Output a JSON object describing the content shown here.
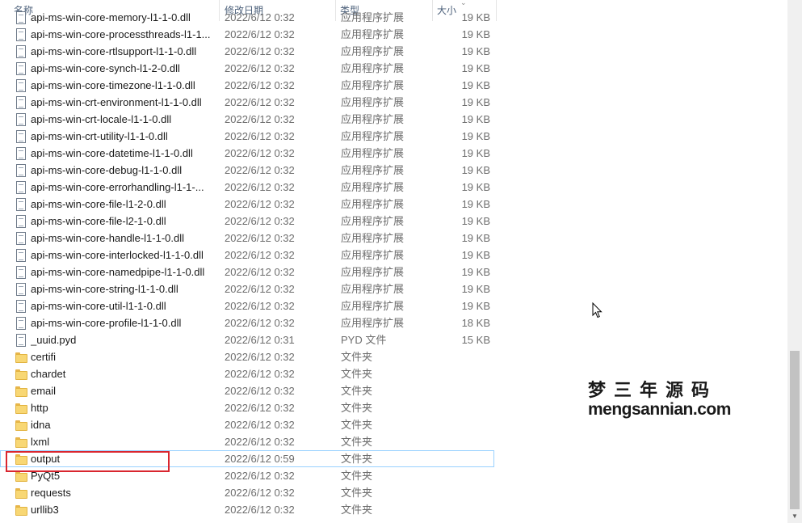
{
  "header": {
    "name": "名称",
    "date": "修改日期",
    "type": "类型",
    "size": "大小",
    "sort_indicator": "chevron-up-icon"
  },
  "rows": [
    {
      "name": "api-ms-win-core-memory-l1-1-0.dll",
      "date": "2022/6/12 0:32",
      "type": "应用程序扩展",
      "size": "19 KB",
      "icon": "dll-file-icon"
    },
    {
      "name": "api-ms-win-core-processthreads-l1-1...",
      "date": "2022/6/12 0:32",
      "type": "应用程序扩展",
      "size": "19 KB",
      "icon": "dll-file-icon"
    },
    {
      "name": "api-ms-win-core-rtlsupport-l1-1-0.dll",
      "date": "2022/6/12 0:32",
      "type": "应用程序扩展",
      "size": "19 KB",
      "icon": "dll-file-icon"
    },
    {
      "name": "api-ms-win-core-synch-l1-2-0.dll",
      "date": "2022/6/12 0:32",
      "type": "应用程序扩展",
      "size": "19 KB",
      "icon": "dll-file-icon"
    },
    {
      "name": "api-ms-win-core-timezone-l1-1-0.dll",
      "date": "2022/6/12 0:32",
      "type": "应用程序扩展",
      "size": "19 KB",
      "icon": "dll-file-icon"
    },
    {
      "name": "api-ms-win-crt-environment-l1-1-0.dll",
      "date": "2022/6/12 0:32",
      "type": "应用程序扩展",
      "size": "19 KB",
      "icon": "dll-file-icon"
    },
    {
      "name": "api-ms-win-crt-locale-l1-1-0.dll",
      "date": "2022/6/12 0:32",
      "type": "应用程序扩展",
      "size": "19 KB",
      "icon": "dll-file-icon"
    },
    {
      "name": "api-ms-win-crt-utility-l1-1-0.dll",
      "date": "2022/6/12 0:32",
      "type": "应用程序扩展",
      "size": "19 KB",
      "icon": "dll-file-icon"
    },
    {
      "name": "api-ms-win-core-datetime-l1-1-0.dll",
      "date": "2022/6/12 0:32",
      "type": "应用程序扩展",
      "size": "19 KB",
      "icon": "dll-file-icon"
    },
    {
      "name": "api-ms-win-core-debug-l1-1-0.dll",
      "date": "2022/6/12 0:32",
      "type": "应用程序扩展",
      "size": "19 KB",
      "icon": "dll-file-icon"
    },
    {
      "name": "api-ms-win-core-errorhandling-l1-1-...",
      "date": "2022/6/12 0:32",
      "type": "应用程序扩展",
      "size": "19 KB",
      "icon": "dll-file-icon"
    },
    {
      "name": "api-ms-win-core-file-l1-2-0.dll",
      "date": "2022/6/12 0:32",
      "type": "应用程序扩展",
      "size": "19 KB",
      "icon": "dll-file-icon"
    },
    {
      "name": "api-ms-win-core-file-l2-1-0.dll",
      "date": "2022/6/12 0:32",
      "type": "应用程序扩展",
      "size": "19 KB",
      "icon": "dll-file-icon"
    },
    {
      "name": "api-ms-win-core-handle-l1-1-0.dll",
      "date": "2022/6/12 0:32",
      "type": "应用程序扩展",
      "size": "19 KB",
      "icon": "dll-file-icon"
    },
    {
      "name": "api-ms-win-core-interlocked-l1-1-0.dll",
      "date": "2022/6/12 0:32",
      "type": "应用程序扩展",
      "size": "19 KB",
      "icon": "dll-file-icon"
    },
    {
      "name": "api-ms-win-core-namedpipe-l1-1-0.dll",
      "date": "2022/6/12 0:32",
      "type": "应用程序扩展",
      "size": "19 KB",
      "icon": "dll-file-icon"
    },
    {
      "name": "api-ms-win-core-string-l1-1-0.dll",
      "date": "2022/6/12 0:32",
      "type": "应用程序扩展",
      "size": "19 KB",
      "icon": "dll-file-icon"
    },
    {
      "name": "api-ms-win-core-util-l1-1-0.dll",
      "date": "2022/6/12 0:32",
      "type": "应用程序扩展",
      "size": "19 KB",
      "icon": "dll-file-icon"
    },
    {
      "name": "api-ms-win-core-profile-l1-1-0.dll",
      "date": "2022/6/12 0:32",
      "type": "应用程序扩展",
      "size": "18 KB",
      "icon": "dll-file-icon"
    },
    {
      "name": "_uuid.pyd",
      "date": "2022/6/12 0:31",
      "type": "PYD 文件",
      "size": "15 KB",
      "icon": "file-icon"
    },
    {
      "name": "certifi",
      "date": "2022/6/12 0:32",
      "type": "文件夹",
      "size": "",
      "icon": "folder-icon"
    },
    {
      "name": "chardet",
      "date": "2022/6/12 0:32",
      "type": "文件夹",
      "size": "",
      "icon": "folder-icon"
    },
    {
      "name": "email",
      "date": "2022/6/12 0:32",
      "type": "文件夹",
      "size": "",
      "icon": "folder-icon"
    },
    {
      "name": "http",
      "date": "2022/6/12 0:32",
      "type": "文件夹",
      "size": "",
      "icon": "folder-icon"
    },
    {
      "name": "idna",
      "date": "2022/6/12 0:32",
      "type": "文件夹",
      "size": "",
      "icon": "folder-icon"
    },
    {
      "name": "lxml",
      "date": "2022/6/12 0:32",
      "type": "文件夹",
      "size": "",
      "icon": "folder-icon"
    },
    {
      "name": "output",
      "date": "2022/6/12 0:59",
      "type": "文件夹",
      "size": "",
      "icon": "folder-icon",
      "selected": true
    },
    {
      "name": "PyQt5",
      "date": "2022/6/12 0:32",
      "type": "文件夹",
      "size": "",
      "icon": "folder-icon"
    },
    {
      "name": "requests",
      "date": "2022/6/12 0:32",
      "type": "文件夹",
      "size": "",
      "icon": "folder-icon"
    },
    {
      "name": "urllib3",
      "date": "2022/6/12 0:32",
      "type": "文件夹",
      "size": "",
      "icon": "folder-icon"
    }
  ],
  "watermark": {
    "cn": "梦三年源码",
    "en": "mengsannian.com"
  },
  "colors": {
    "highlight_border": "#d9262f",
    "selection_border": "#99d1ff",
    "folder": "#f8d774"
  }
}
